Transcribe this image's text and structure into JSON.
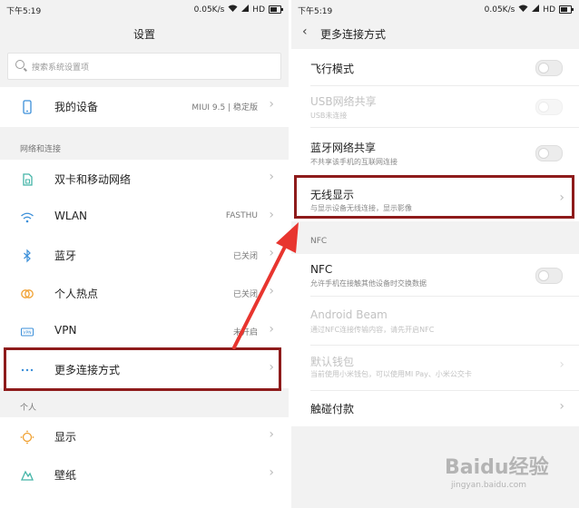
{
  "left": {
    "status": {
      "time": "下午5:19",
      "speed": "0.05K/s",
      "network": "HD"
    },
    "title": "设置",
    "search_placeholder": "搜索系统设置项",
    "device": {
      "label": "我的设备",
      "value": "MIUI 9.5 | 稳定版"
    },
    "section_network": "网络和连接",
    "network_items": [
      {
        "label": "双卡和移动网络",
        "value": ""
      },
      {
        "label": "WLAN",
        "value": "FASTHU"
      },
      {
        "label": "蓝牙",
        "value": "已关闭"
      },
      {
        "label": "个人热点",
        "value": "已关闭"
      },
      {
        "label": "VPN",
        "value": "未开启"
      },
      {
        "label": "更多连接方式",
        "value": ""
      }
    ],
    "section_personal": "个人",
    "personal_items": [
      {
        "label": "显示"
      },
      {
        "label": "壁纸"
      }
    ]
  },
  "right": {
    "status": {
      "time": "下午5:19",
      "speed": "0.05K/s",
      "network": "HD"
    },
    "title": "更多连接方式",
    "items": [
      {
        "title": "飞行模式",
        "subtitle": "",
        "control": "toggle",
        "enabled": true
      },
      {
        "title": "USB网络共享",
        "subtitle": "USB未连接",
        "control": "toggle",
        "enabled": false
      },
      {
        "title": "蓝牙网络共享",
        "subtitle": "不共享该手机的互联网连接",
        "control": "toggle",
        "enabled": true
      },
      {
        "title": "无线显示",
        "subtitle": "与显示设备无线连接，显示影像",
        "control": "chevron",
        "enabled": true
      }
    ],
    "section_nfc": "NFC",
    "nfc_items": [
      {
        "title": "NFC",
        "subtitle": "允许手机在接触其他设备时交换数据",
        "control": "toggle",
        "enabled": true
      },
      {
        "title": "Android Beam",
        "subtitle": "通过NFC连接传输内容，请先开启NFC",
        "control": "none",
        "enabled": false
      },
      {
        "title": "默认钱包",
        "subtitle": "当前使用小米钱包，可以使用MI Pay、小米公交卡",
        "control": "chevron",
        "enabled": false
      },
      {
        "title": "触碰付款",
        "subtitle": "",
        "control": "chevron",
        "enabled": true
      }
    ]
  },
  "watermark": {
    "brand": "Baidu",
    "cn": "经验",
    "url": "jingyan.baidu.com"
  },
  "colors": {
    "highlight": "#8e1b1b",
    "arrow": "#e8352f",
    "icon_blue": "#3b8fd9"
  }
}
